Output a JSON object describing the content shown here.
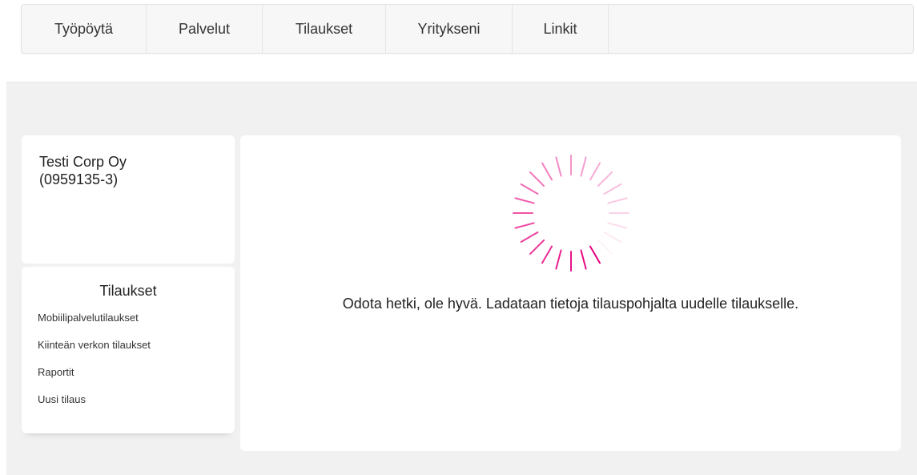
{
  "nav": {
    "items": [
      {
        "label": "Työpöytä"
      },
      {
        "label": "Palvelut"
      },
      {
        "label": "Tilaukset"
      },
      {
        "label": "Yritykseni"
      },
      {
        "label": "Linkit"
      }
    ]
  },
  "company": {
    "name": "Testi Corp Oy",
    "business_id": "(0959135-3)"
  },
  "orders_menu": {
    "title": "Tilaukset",
    "links": [
      {
        "label": "Mobiilipalvelutilaukset"
      },
      {
        "label": "Kiinteän verkon tilaukset"
      },
      {
        "label": "Raportit"
      },
      {
        "label": "Uusi tilaus"
      }
    ]
  },
  "main": {
    "loading_message": "Odota hetki, ole hyvä. Ladataan tietoja tilauspohjalta uudelle tilaukselle.",
    "spinner_icon": "loading-spinner-icon"
  },
  "colors": {
    "accent": "#e6007e",
    "page_bg": "#f1f1f1",
    "nav_bg": "#f7f7f7"
  }
}
